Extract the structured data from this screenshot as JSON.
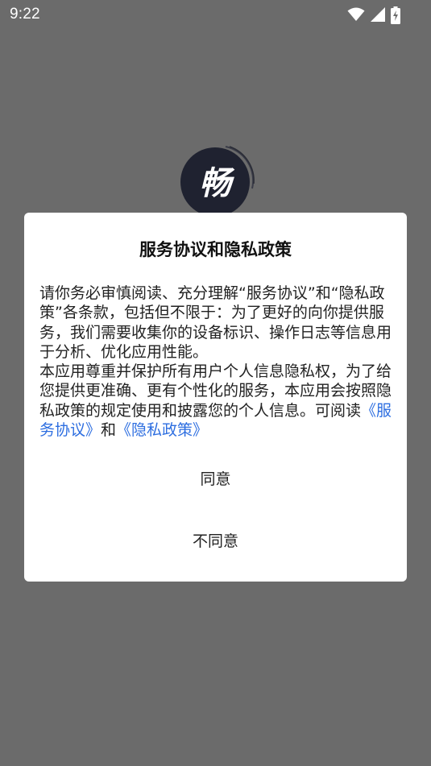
{
  "status_bar": {
    "time": "9:22",
    "icons": [
      "wifi-icon",
      "signal-icon",
      "battery-charging-icon"
    ]
  },
  "logo": {
    "glyph": "畅",
    "icon": "app-logo-icon"
  },
  "dialog": {
    "title": "服务协议和隐私政策",
    "body": {
      "paragraph1": "请你务必审慎阅读、充分理解“服务协议”和“隐私政策”各条款，包括但不限于：为了更好的向你提供服务，我们需要收集你的设备标识、操作日志等信息用于分析、优化应用性能。",
      "paragraph2_prefix": "本应用尊重并保护所有用户个人信息隐私权，为了给您提供更准确、更有个性化的服务，本应用会按照隐私政策的规定使用和披露您的个人信息。可阅读",
      "service_link": "《服务协议》",
      "conjunction": "和",
      "privacy_link": "《隐私政策》"
    },
    "agree_label": "同意",
    "disagree_label": "不同意"
  },
  "colors": {
    "overlay": "#6b6b6b",
    "link": "#2d6ee0",
    "dialog_bg": "#ffffff",
    "logo_bg": "#1f2230"
  }
}
